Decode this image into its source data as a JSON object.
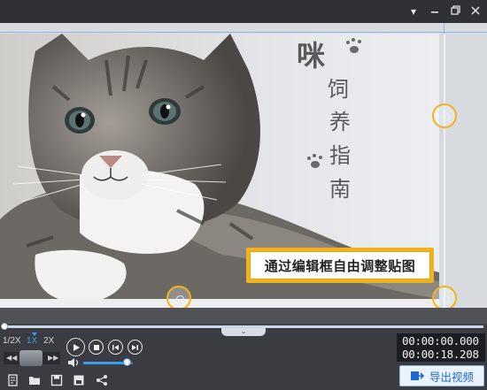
{
  "window": {
    "controls": [
      "menu-arrow-icon",
      "minimize-icon",
      "restore-icon",
      "close-icon"
    ]
  },
  "video": {
    "vertical_title": [
      "咪",
      "饲",
      "养",
      "指",
      "南"
    ],
    "caption": "通过编辑框自由调整贴图"
  },
  "playback": {
    "speeds": [
      "1/2X",
      "1X",
      "2X"
    ],
    "active_speed": "1X",
    "volume_level": 0.9,
    "current_time": "00:00:00.000",
    "total_time": "00:00:18.208"
  },
  "toolbar": {
    "icons": [
      "new-project-icon",
      "open-folder-icon",
      "save-icon",
      "save-as-icon",
      "share-icon"
    ],
    "export_label": "导出视频"
  },
  "colors": {
    "accent": "#3a9df0",
    "handle": "#f0b41e",
    "caption_border": "#f2b21b"
  }
}
